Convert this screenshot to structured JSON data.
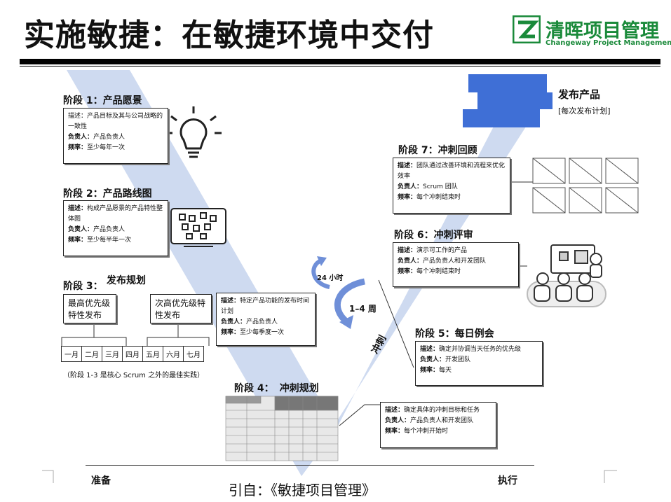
{
  "title": "实施敏捷：在敏捷环境中交付",
  "logo": {
    "name_cn": "清晖项目管理",
    "name_en": "Changeway Project Management",
    "color": "#1a8a3a"
  },
  "stages": [
    {
      "label": "阶段 1：",
      "title": "产品愿景",
      "desc_label": "描述：",
      "desc": "产品目标及其与公司战略的一致性",
      "owner_label": "负责人：",
      "owner": "产品负责人",
      "freq_label": "频率：",
      "freq": "至少每年一次"
    },
    {
      "label": "阶段 2：",
      "title": "产品路线图",
      "desc_label": "描述：",
      "desc": "构成产品愿景的产品特性整体图",
      "owner_label": "负责人：",
      "owner": "产品负责人",
      "freq_label": "频率：",
      "freq": "至少每半年一次"
    },
    {
      "label": "阶段 3：",
      "title": "发布规划",
      "desc_label": "描述：",
      "desc": "特定产品功能的发布时间计划",
      "owner_label": "负责人：",
      "owner": "产品负责人",
      "freq_label": "频率：",
      "freq": "至少每季度一次"
    },
    {
      "label": "阶段 4：",
      "title": "冲刺规划",
      "desc_label": "描述：",
      "desc": "确定具体的冲刺目标和任务",
      "owner_label": "负责人：",
      "owner": "产品负责人和开发团队",
      "freq_label": "频率：",
      "freq": "每个冲刺开始时"
    },
    {
      "label": "阶段 5：",
      "title": "每日例会",
      "desc_label": "描述：",
      "desc": "确定并协调当天任务的优先级",
      "owner_label": "负责人：",
      "owner": "开发团队",
      "freq_label": "频率：",
      "freq": "每天"
    },
    {
      "label": "阶段 6：",
      "title": "冲刺评审",
      "desc_label": "描述：",
      "desc": "演示可工作的产品",
      "owner_label": "负责人：",
      "owner": "产品负责人和开发团队",
      "freq_label": "频率：",
      "freq": "每个冲刺结束时"
    },
    {
      "label": "阶段 7：",
      "title": "冲刺回顾",
      "desc_label": "描述：",
      "desc": "团队通过改善环境和流程来优化效率",
      "owner_label": "负责人：",
      "owner": "Scrum 团队",
      "freq_label": "频率：",
      "freq": "每个冲刺结束时"
    }
  ],
  "release": {
    "title": "发布产品",
    "subtitle": "[每次发布计划]"
  },
  "features": {
    "top": "最高优先级特性发布",
    "next": "次高优先级特性发布"
  },
  "months": [
    "一月",
    "二月",
    "三月",
    "四月",
    "五月",
    "六月",
    "七月"
  ],
  "note": "（阶段 1-3 是核心 Scrum 之外的最佳实践）",
  "cycle": {
    "day": "24 小时",
    "weeks": "1–4 周",
    "sprint": "冲刺"
  },
  "footer": {
    "prepare": "准备",
    "execute": "执行",
    "citation": "引自：《敏捷项目管理》"
  },
  "colors": {
    "v_shape": "#c9d6ee",
    "release_blocks": "#3f6fd6",
    "cycle_arrow": "#6f8fd8"
  }
}
